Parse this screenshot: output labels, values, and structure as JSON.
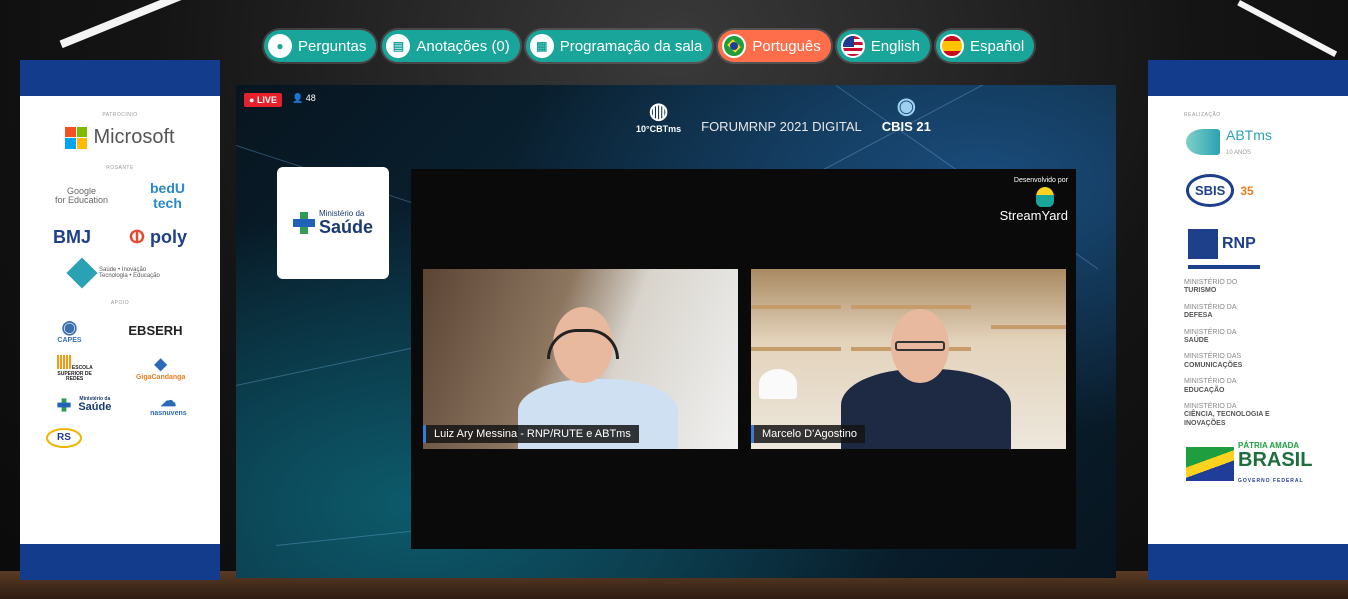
{
  "nav": {
    "items": [
      {
        "label": "Perguntas",
        "icon": "chat-icon",
        "active": false
      },
      {
        "label": "Anotações (0)",
        "icon": "notes-icon",
        "active": false
      },
      {
        "label": "Programação da sala",
        "icon": "calendar-icon",
        "active": false
      },
      {
        "label": "Português",
        "icon": "brazil-flag-icon",
        "active": true
      },
      {
        "label": "English",
        "icon": "us-flag-icon",
        "active": false
      },
      {
        "label": "Español",
        "icon": "spain-flag-icon",
        "active": false
      }
    ]
  },
  "left_banner": {
    "sec1": "PATROCINIO",
    "microsoft": "Microsoft",
    "sec2": "ROSANTE",
    "google_a": "Google",
    "google_b": "for Education",
    "bedu_a": "bedU",
    "bedu_b": "tech",
    "bmj": "BMJ",
    "poly": "poly",
    "sabe": "Saúde • Inovação Tecnologia • Educação",
    "sec3": "APOIO",
    "capes": "CAPES",
    "ebserh": "EBSERH",
    "escola": "ESCOLA SUPERIOR DE REDES",
    "gigacandanga": "GigaCandanga",
    "ms_small_a": "Ministério da",
    "ms_small_b": "Saúde",
    "nasnuvens": "nasnuvens",
    "rs": "RS"
  },
  "right_banner": {
    "sec1": "REALIZAÇÃO",
    "abtms": "ABTms",
    "abtms_sub": "10 ANOS",
    "sbis": "SBIS",
    "sbis_num": "35",
    "rnp": "RNP",
    "ministries": [
      {
        "a": "MINISTÉRIO DO",
        "b": "TURISMO"
      },
      {
        "a": "MINISTÉRIO DA",
        "b": "DEFESA"
      },
      {
        "a": "MINISTÉRIO DA",
        "b": "SAÚDE"
      },
      {
        "a": "MINISTÉRIO DAS",
        "b": "COMUNICAÇÕES"
      },
      {
        "a": "MINISTÉRIO DA",
        "b": "EDUCAÇÃO"
      },
      {
        "a": "MINISTÉRIO DA",
        "b": "CIÊNCIA, TECNOLOGIA E INOVAÇÕES"
      }
    ],
    "patria_a": "PÁTRIA AMADA",
    "patria_b": "BRASIL",
    "patria_c": "GOVERNO FEDERAL"
  },
  "screen": {
    "live": "LIVE",
    "viewers": "48",
    "event_logos": [
      "10°CBTms",
      "FORUMRNP 2021 DIGITAL",
      "CBIS 21"
    ],
    "ms_saude_line1": "Ministério da",
    "ms_saude_line2": "Saúde",
    "developed_by": "Desenvolvido por",
    "streamyard": "StreamYard",
    "speakers": [
      {
        "name": "Luiz Ary Messina - RNP/RUTE e ABTms"
      },
      {
        "name": "Marcelo D'Agostino"
      }
    ]
  }
}
